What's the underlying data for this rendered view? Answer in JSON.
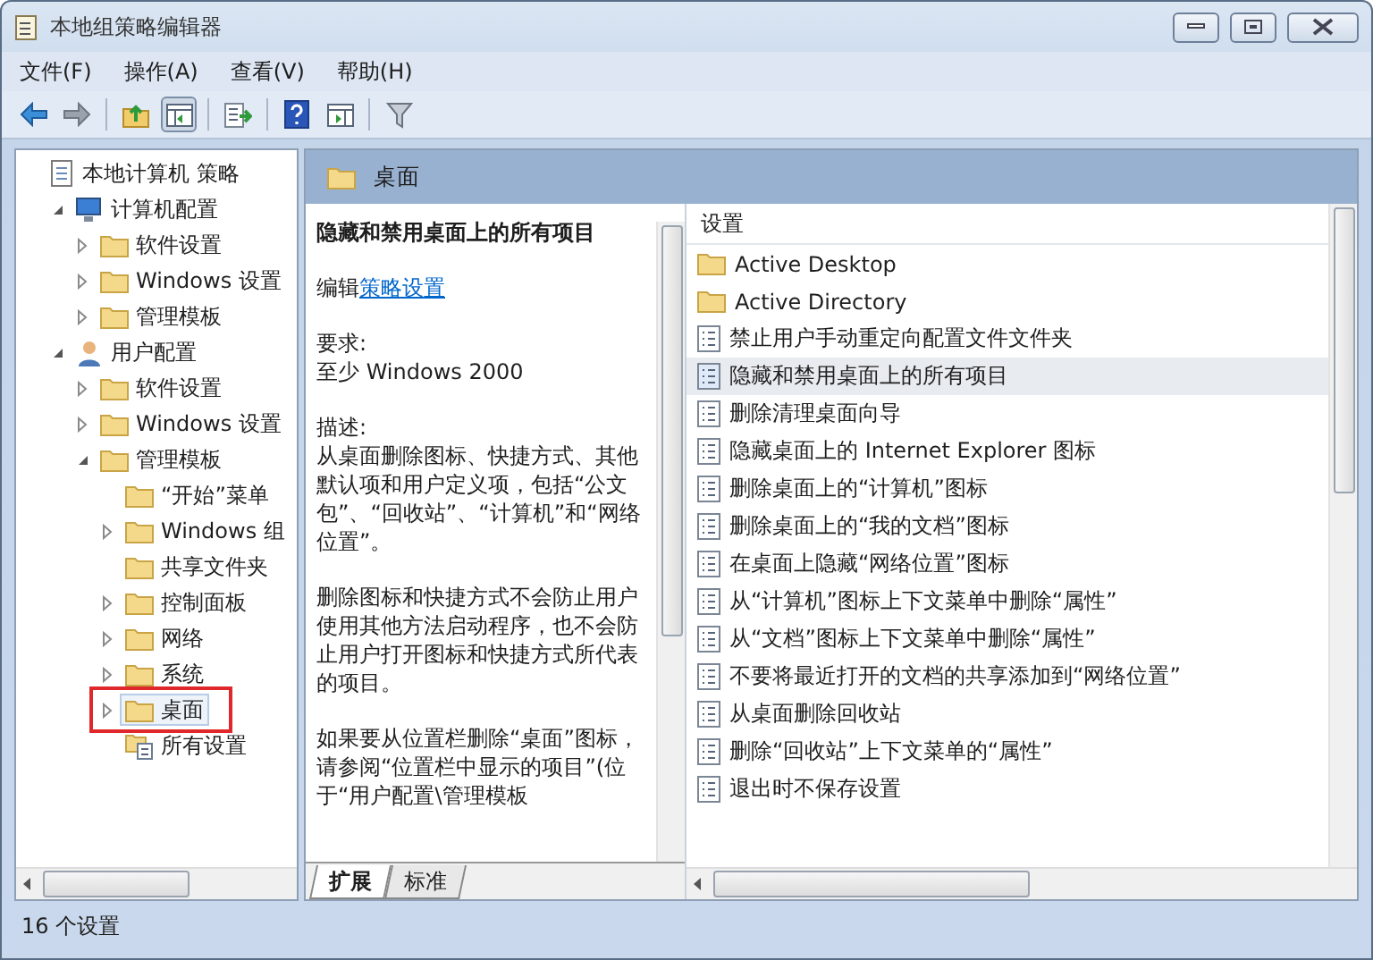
{
  "window": {
    "title": "本地组策略编辑器"
  },
  "menu": [
    "文件(F)",
    "操作(A)",
    "查看(V)",
    "帮助(H)"
  ],
  "toolbar": [
    {
      "kind": "back"
    },
    {
      "kind": "forward"
    },
    {
      "kind": "sep"
    },
    {
      "kind": "up"
    },
    {
      "kind": "tree",
      "selected": true
    },
    {
      "kind": "sep"
    },
    {
      "kind": "export"
    },
    {
      "kind": "sep"
    },
    {
      "kind": "help"
    },
    {
      "kind": "pane",
      "selected": false
    },
    {
      "kind": "sep"
    },
    {
      "kind": "filter"
    }
  ],
  "tree": [
    {
      "label": "本地计算机 策略",
      "kind": "policy",
      "selected": false,
      "children": [
        {
          "label": "计算机配置",
          "kind": "computer",
          "expanded": true,
          "selected": false,
          "children": [
            {
              "label": "软件设置",
              "kind": "folder",
              "expanded": false,
              "selected": false
            },
            {
              "label": "Windows 设置",
              "kind": "folder",
              "expanded": false,
              "selected": false
            },
            {
              "label": "管理模板",
              "kind": "folder",
              "expanded": false,
              "selected": false
            }
          ]
        },
        {
          "label": "用户配置",
          "kind": "user",
          "expanded": true,
          "selected": false,
          "children": [
            {
              "label": "软件设置",
              "kind": "folder",
              "expanded": false,
              "selected": false
            },
            {
              "label": "Windows 设置",
              "kind": "folder",
              "expanded": false,
              "selected": false
            },
            {
              "label": "管理模板",
              "kind": "folder",
              "expanded": true,
              "selected": false,
              "children": [
                {
                  "label": "“开始”菜单",
                  "kind": "folder",
                  "selected": false
                },
                {
                  "label": "Windows 组",
                  "kind": "folder",
                  "expanded": false,
                  "selected": false
                },
                {
                  "label": "共享文件夹",
                  "kind": "folder",
                  "selected": false
                },
                {
                  "label": "控制面板",
                  "kind": "folder",
                  "expanded": false,
                  "selected": false
                },
                {
                  "label": "网络",
                  "kind": "folder",
                  "expanded": false,
                  "selected": false
                },
                {
                  "label": "系统",
                  "kind": "folder",
                  "expanded": false,
                  "selected": false
                },
                {
                  "label": "桌面",
                  "kind": "folder",
                  "expanded": false,
                  "selected": true,
                  "callout": true
                },
                {
                  "label": "所有设置",
                  "kind": "settings",
                  "selected": false
                }
              ]
            }
          ]
        }
      ]
    }
  ],
  "header": {
    "title": "桌面"
  },
  "description": {
    "title": "隐藏和禁用桌面上的所有项目",
    "edit_prefix": "编辑",
    "edit_link": "策略设置",
    "requirement_label": "要求:",
    "requirement": "至少 Windows 2000",
    "description_label": "描述:",
    "paragraphs": [
      "从桌面删除图标、快捷方式、其他默认项和用户定义项，包括“公文包”、“回收站”、“计算机”和“网络位置”。",
      "删除图标和快捷方式不会防止用户使用其他方法启动程序，也不会防止用户打开图标和快捷方式所代表的项目。",
      "如果要从位置栏删除“桌面”图标，请参阅“位置栏中显示的项目”(位于“用户配置\\管理模板"
    ]
  },
  "tabs": [
    {
      "label": "扩展",
      "selected": true
    },
    {
      "label": "标准",
      "selected": false
    }
  ],
  "list": {
    "column": "设置",
    "items": [
      {
        "label": "Active Desktop",
        "kind": "folder",
        "selected": false
      },
      {
        "label": "Active Directory",
        "kind": "folder",
        "selected": false
      },
      {
        "label": "禁止用户手动重定向配置文件文件夹",
        "kind": "policy",
        "selected": false
      },
      {
        "label": "隐藏和禁用桌面上的所有项目",
        "kind": "policy",
        "selected": true
      },
      {
        "label": "删除清理桌面向导",
        "kind": "policy",
        "selected": false
      },
      {
        "label": "隐藏桌面上的 Internet Explorer 图标",
        "kind": "policy",
        "selected": false
      },
      {
        "label": "删除桌面上的“计算机”图标",
        "kind": "policy",
        "selected": false
      },
      {
        "label": "删除桌面上的“我的文档”图标",
        "kind": "policy",
        "selected": false
      },
      {
        "label": "在桌面上隐藏“网络位置”图标",
        "kind": "policy",
        "selected": false
      },
      {
        "label": "从“计算机”图标上下文菜单中删除“属性”",
        "kind": "policy",
        "selected": false
      },
      {
        "label": "从“文档”图标上下文菜单中删除“属性”",
        "kind": "policy",
        "selected": false
      },
      {
        "label": "不要将最近打开的文档的共享添加到“网络位置”",
        "kind": "policy",
        "selected": false
      },
      {
        "label": "从桌面删除回收站",
        "kind": "policy",
        "selected": false
      },
      {
        "label": "删除“回收站”上下文菜单的“属性”",
        "kind": "policy",
        "selected": false
      },
      {
        "label": "退出时不保存设置",
        "kind": "policy",
        "selected": false
      }
    ]
  },
  "status_bar": {
    "text": "16 个设置"
  }
}
